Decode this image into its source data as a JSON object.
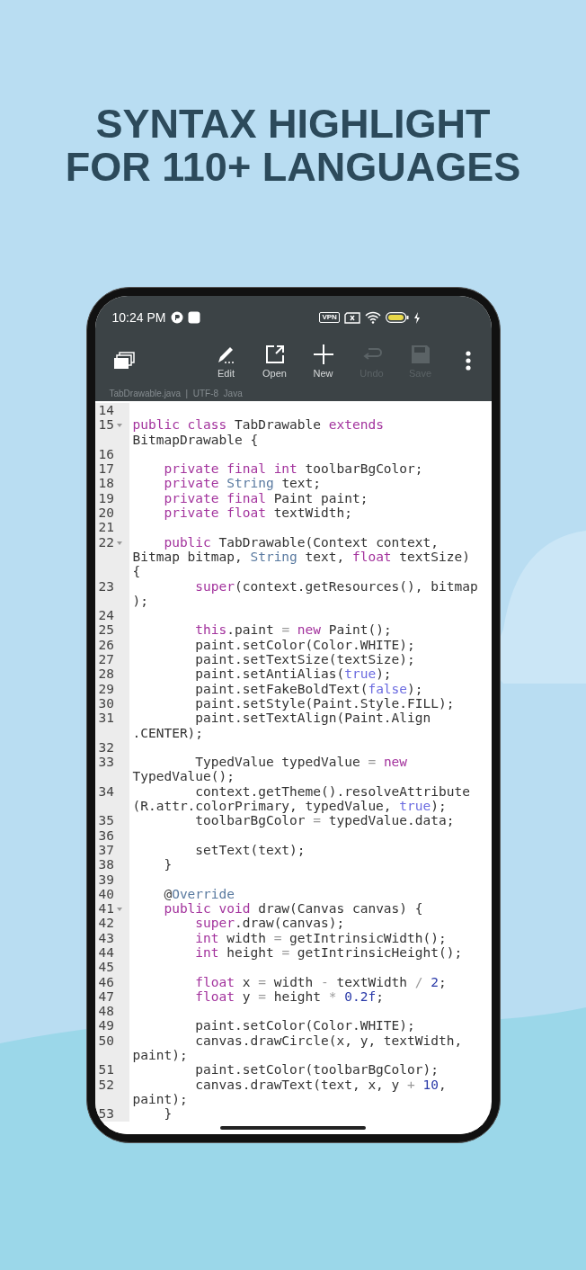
{
  "headline": [
    "SYNTAX HIGHLIGHT",
    "FOR 110+ LANGUAGES"
  ],
  "status_bar": {
    "time": "10:24 PM",
    "vpn": "VPN"
  },
  "toolbar": {
    "buttons": [
      {
        "kind": "edit",
        "label": "Edit",
        "disabled": false
      },
      {
        "kind": "open",
        "label": "Open",
        "disabled": false
      },
      {
        "kind": "new",
        "label": "New",
        "disabled": false
      },
      {
        "kind": "undo",
        "label": "Undo",
        "disabled": true
      },
      {
        "kind": "save",
        "label": "Save",
        "disabled": true
      }
    ]
  },
  "file_info": "TabDrawable.java  |  UTF-8  Java",
  "code": [
    {
      "number": "14",
      "fold": false
    },
    {
      "number": "15",
      "fold": true,
      "rows": [
        {
          "tokens": [
            {
              "kind": "kw",
              "text": "public class"
            },
            {
              "kind": "p",
              "text": " TabDrawable "
            },
            {
              "kind": "kw",
              "text": "extends"
            }
          ]
        },
        {
          "tokens": [
            {
              "kind": "p",
              "text": "BitmapDrawable {"
            }
          ]
        }
      ]
    },
    {
      "number": "16",
      "fold": false
    },
    {
      "number": "17",
      "fold": false,
      "rows": [
        {
          "tokens": [
            {
              "kind": "kw",
              "text": "    private final int"
            },
            {
              "kind": "p",
              "text": " toolbarBgColor;"
            }
          ]
        }
      ]
    },
    {
      "number": "18",
      "fold": false,
      "rows": [
        {
          "tokens": [
            {
              "kind": "kw",
              "text": "    private "
            },
            {
              "kind": "ty",
              "text": "String"
            },
            {
              "kind": "p",
              "text": " text;"
            }
          ]
        }
      ]
    },
    {
      "number": "19",
      "fold": false,
      "rows": [
        {
          "tokens": [
            {
              "kind": "kw",
              "text": "    private final"
            },
            {
              "kind": "p",
              "text": " Paint paint;"
            }
          ]
        }
      ]
    },
    {
      "number": "20",
      "fold": false,
      "rows": [
        {
          "tokens": [
            {
              "kind": "kw",
              "text": "    private float"
            },
            {
              "kind": "p",
              "text": " textWidth;"
            }
          ]
        }
      ]
    },
    {
      "number": "21",
      "fold": false
    },
    {
      "number": "22",
      "fold": true,
      "rows": [
        {
          "tokens": [
            {
              "kind": "kw",
              "text": "    public"
            },
            {
              "kind": "p",
              "text": " TabDrawable(Context context,"
            }
          ]
        },
        {
          "tokens": [
            {
              "kind": "p",
              "text": "Bitmap bitmap, "
            },
            {
              "kind": "ty",
              "text": "String"
            },
            {
              "kind": "p",
              "text": " text, "
            },
            {
              "kind": "kw",
              "text": "float"
            },
            {
              "kind": "p",
              "text": " textSize)"
            }
          ]
        },
        {
          "tokens": [
            {
              "kind": "p",
              "text": "{"
            }
          ]
        }
      ]
    },
    {
      "number": "23",
      "fold": false,
      "rows": [
        {
          "tokens": [
            {
              "kind": "kw",
              "text": "        super"
            },
            {
              "kind": "p",
              "text": "(context.getResources(), bitmap"
            }
          ]
        },
        {
          "tokens": [
            {
              "kind": "p",
              "text": ");"
            }
          ]
        }
      ]
    },
    {
      "number": "24",
      "fold": false
    },
    {
      "number": "25",
      "fold": false,
      "rows": [
        {
          "tokens": [
            {
              "kind": "kw",
              "text": "        this"
            },
            {
              "kind": "p",
              "text": ".paint "
            },
            {
              "kind": "op",
              "text": "= "
            },
            {
              "kind": "kw",
              "text": "new"
            },
            {
              "kind": "p",
              "text": " Paint();"
            }
          ]
        }
      ]
    },
    {
      "number": "26",
      "fold": false,
      "rows": [
        {
          "tokens": [
            {
              "kind": "p",
              "text": "        paint.setColor(Color.WHITE);"
            }
          ]
        }
      ]
    },
    {
      "number": "27",
      "fold": false,
      "rows": [
        {
          "tokens": [
            {
              "kind": "p",
              "text": "        paint.setTextSize(textSize);"
            }
          ]
        }
      ]
    },
    {
      "number": "28",
      "fold": false,
      "rows": [
        {
          "tokens": [
            {
              "kind": "p",
              "text": "        paint.setAntiAlias("
            },
            {
              "kind": "lit",
              "text": "true"
            },
            {
              "kind": "p",
              "text": ");"
            }
          ]
        }
      ]
    },
    {
      "number": "29",
      "fold": false,
      "rows": [
        {
          "tokens": [
            {
              "kind": "p",
              "text": "        paint.setFakeBoldText("
            },
            {
              "kind": "lit",
              "text": "false"
            },
            {
              "kind": "p",
              "text": ");"
            }
          ]
        }
      ]
    },
    {
      "number": "30",
      "fold": false,
      "rows": [
        {
          "tokens": [
            {
              "kind": "p",
              "text": "        paint.setStyle(Paint.Style.FILL);"
            }
          ]
        }
      ]
    },
    {
      "number": "31",
      "fold": false,
      "rows": [
        {
          "tokens": [
            {
              "kind": "p",
              "text": "        paint.setTextAlign(Paint.Align"
            }
          ]
        },
        {
          "tokens": [
            {
              "kind": "p",
              "text": ".CENTER);"
            }
          ]
        }
      ]
    },
    {
      "number": "32",
      "fold": false
    },
    {
      "number": "33",
      "fold": false,
      "rows": [
        {
          "tokens": [
            {
              "kind": "p",
              "text": "        TypedValue typedValue "
            },
            {
              "kind": "op",
              "text": "= "
            },
            {
              "kind": "kw",
              "text": "new"
            }
          ]
        },
        {
          "tokens": [
            {
              "kind": "p",
              "text": "TypedValue();"
            }
          ]
        }
      ]
    },
    {
      "number": "34",
      "fold": false,
      "rows": [
        {
          "tokens": [
            {
              "kind": "p",
              "text": "        context.getTheme().resolveAttribute"
            }
          ]
        },
        {
          "tokens": [
            {
              "kind": "p",
              "text": "(R.attr.colorPrimary, typedValue, "
            },
            {
              "kind": "lit",
              "text": "true"
            },
            {
              "kind": "p",
              "text": ");"
            }
          ]
        }
      ]
    },
    {
      "number": "35",
      "fold": false,
      "rows": [
        {
          "tokens": [
            {
              "kind": "p",
              "text": "        toolbarBgColor "
            },
            {
              "kind": "op",
              "text": "="
            },
            {
              "kind": "p",
              "text": " typedValue.data;"
            }
          ]
        }
      ]
    },
    {
      "number": "36",
      "fold": false
    },
    {
      "number": "37",
      "fold": false,
      "rows": [
        {
          "tokens": [
            {
              "kind": "p",
              "text": "        setText(text);"
            }
          ]
        }
      ]
    },
    {
      "number": "38",
      "fold": false,
      "rows": [
        {
          "tokens": [
            {
              "kind": "p",
              "text": "    }"
            }
          ]
        }
      ]
    },
    {
      "number": "39",
      "fold": false
    },
    {
      "number": "40",
      "fold": false,
      "rows": [
        {
          "tokens": [
            {
              "kind": "p",
              "text": "    @"
            },
            {
              "kind": "ty",
              "text": "Override"
            }
          ]
        }
      ]
    },
    {
      "number": "41",
      "fold": true,
      "rows": [
        {
          "tokens": [
            {
              "kind": "kw",
              "text": "    public void"
            },
            {
              "kind": "p",
              "text": " draw(Canvas canvas) {"
            }
          ]
        }
      ]
    },
    {
      "number": "42",
      "fold": false,
      "rows": [
        {
          "tokens": [
            {
              "kind": "kw",
              "text": "        super"
            },
            {
              "kind": "p",
              "text": ".draw(canvas);"
            }
          ]
        }
      ]
    },
    {
      "number": "43",
      "fold": false,
      "rows": [
        {
          "tokens": [
            {
              "kind": "kw",
              "text": "        int"
            },
            {
              "kind": "p",
              "text": " width "
            },
            {
              "kind": "op",
              "text": "="
            },
            {
              "kind": "p",
              "text": " getIntrinsicWidth();"
            }
          ]
        }
      ]
    },
    {
      "number": "44",
      "fold": false,
      "rows": [
        {
          "tokens": [
            {
              "kind": "kw",
              "text": "        int"
            },
            {
              "kind": "p",
              "text": " height "
            },
            {
              "kind": "op",
              "text": "="
            },
            {
              "kind": "p",
              "text": " getIntrinsicHeight();"
            }
          ]
        }
      ]
    },
    {
      "number": "45",
      "fold": false
    },
    {
      "number": "46",
      "fold": false,
      "rows": [
        {
          "tokens": [
            {
              "kind": "kw",
              "text": "        float"
            },
            {
              "kind": "p",
              "text": " x "
            },
            {
              "kind": "op",
              "text": "="
            },
            {
              "kind": "p",
              "text": " width "
            },
            {
              "kind": "op",
              "text": "-"
            },
            {
              "kind": "p",
              "text": " textWidth "
            },
            {
              "kind": "op",
              "text": "/ "
            },
            {
              "kind": "num",
              "text": "2"
            },
            {
              "kind": "p",
              "text": ";"
            }
          ]
        }
      ]
    },
    {
      "number": "47",
      "fold": false,
      "rows": [
        {
          "tokens": [
            {
              "kind": "kw",
              "text": "        float"
            },
            {
              "kind": "p",
              "text": " y "
            },
            {
              "kind": "op",
              "text": "="
            },
            {
              "kind": "p",
              "text": " height "
            },
            {
              "kind": "op",
              "text": "* "
            },
            {
              "kind": "num",
              "text": "0.2f"
            },
            {
              "kind": "p",
              "text": ";"
            }
          ]
        }
      ]
    },
    {
      "number": "48",
      "fold": false
    },
    {
      "number": "49",
      "fold": false,
      "rows": [
        {
          "tokens": [
            {
              "kind": "p",
              "text": "        paint.setColor(Color.WHITE);"
            }
          ]
        }
      ]
    },
    {
      "number": "50",
      "fold": false,
      "rows": [
        {
          "tokens": [
            {
              "kind": "p",
              "text": "        canvas.drawCircle(x, y, textWidth,"
            }
          ]
        },
        {
          "tokens": [
            {
              "kind": "p",
              "text": "paint);"
            }
          ]
        }
      ]
    },
    {
      "number": "51",
      "fold": false,
      "rows": [
        {
          "tokens": [
            {
              "kind": "p",
              "text": "        paint.setColor(toolbarBgColor);"
            }
          ]
        }
      ]
    },
    {
      "number": "52",
      "fold": false,
      "rows": [
        {
          "tokens": [
            {
              "kind": "p",
              "text": "        canvas.drawText(text, x, y "
            },
            {
              "kind": "op",
              "text": "+ "
            },
            {
              "kind": "num",
              "text": "10"
            },
            {
              "kind": "p",
              "text": ","
            }
          ]
        },
        {
          "tokens": [
            {
              "kind": "p",
              "text": "paint);"
            }
          ]
        }
      ]
    },
    {
      "number": "53",
      "fold": false,
      "rows": [
        {
          "tokens": [
            {
              "kind": "p",
              "text": "    }"
            }
          ]
        }
      ]
    }
  ]
}
